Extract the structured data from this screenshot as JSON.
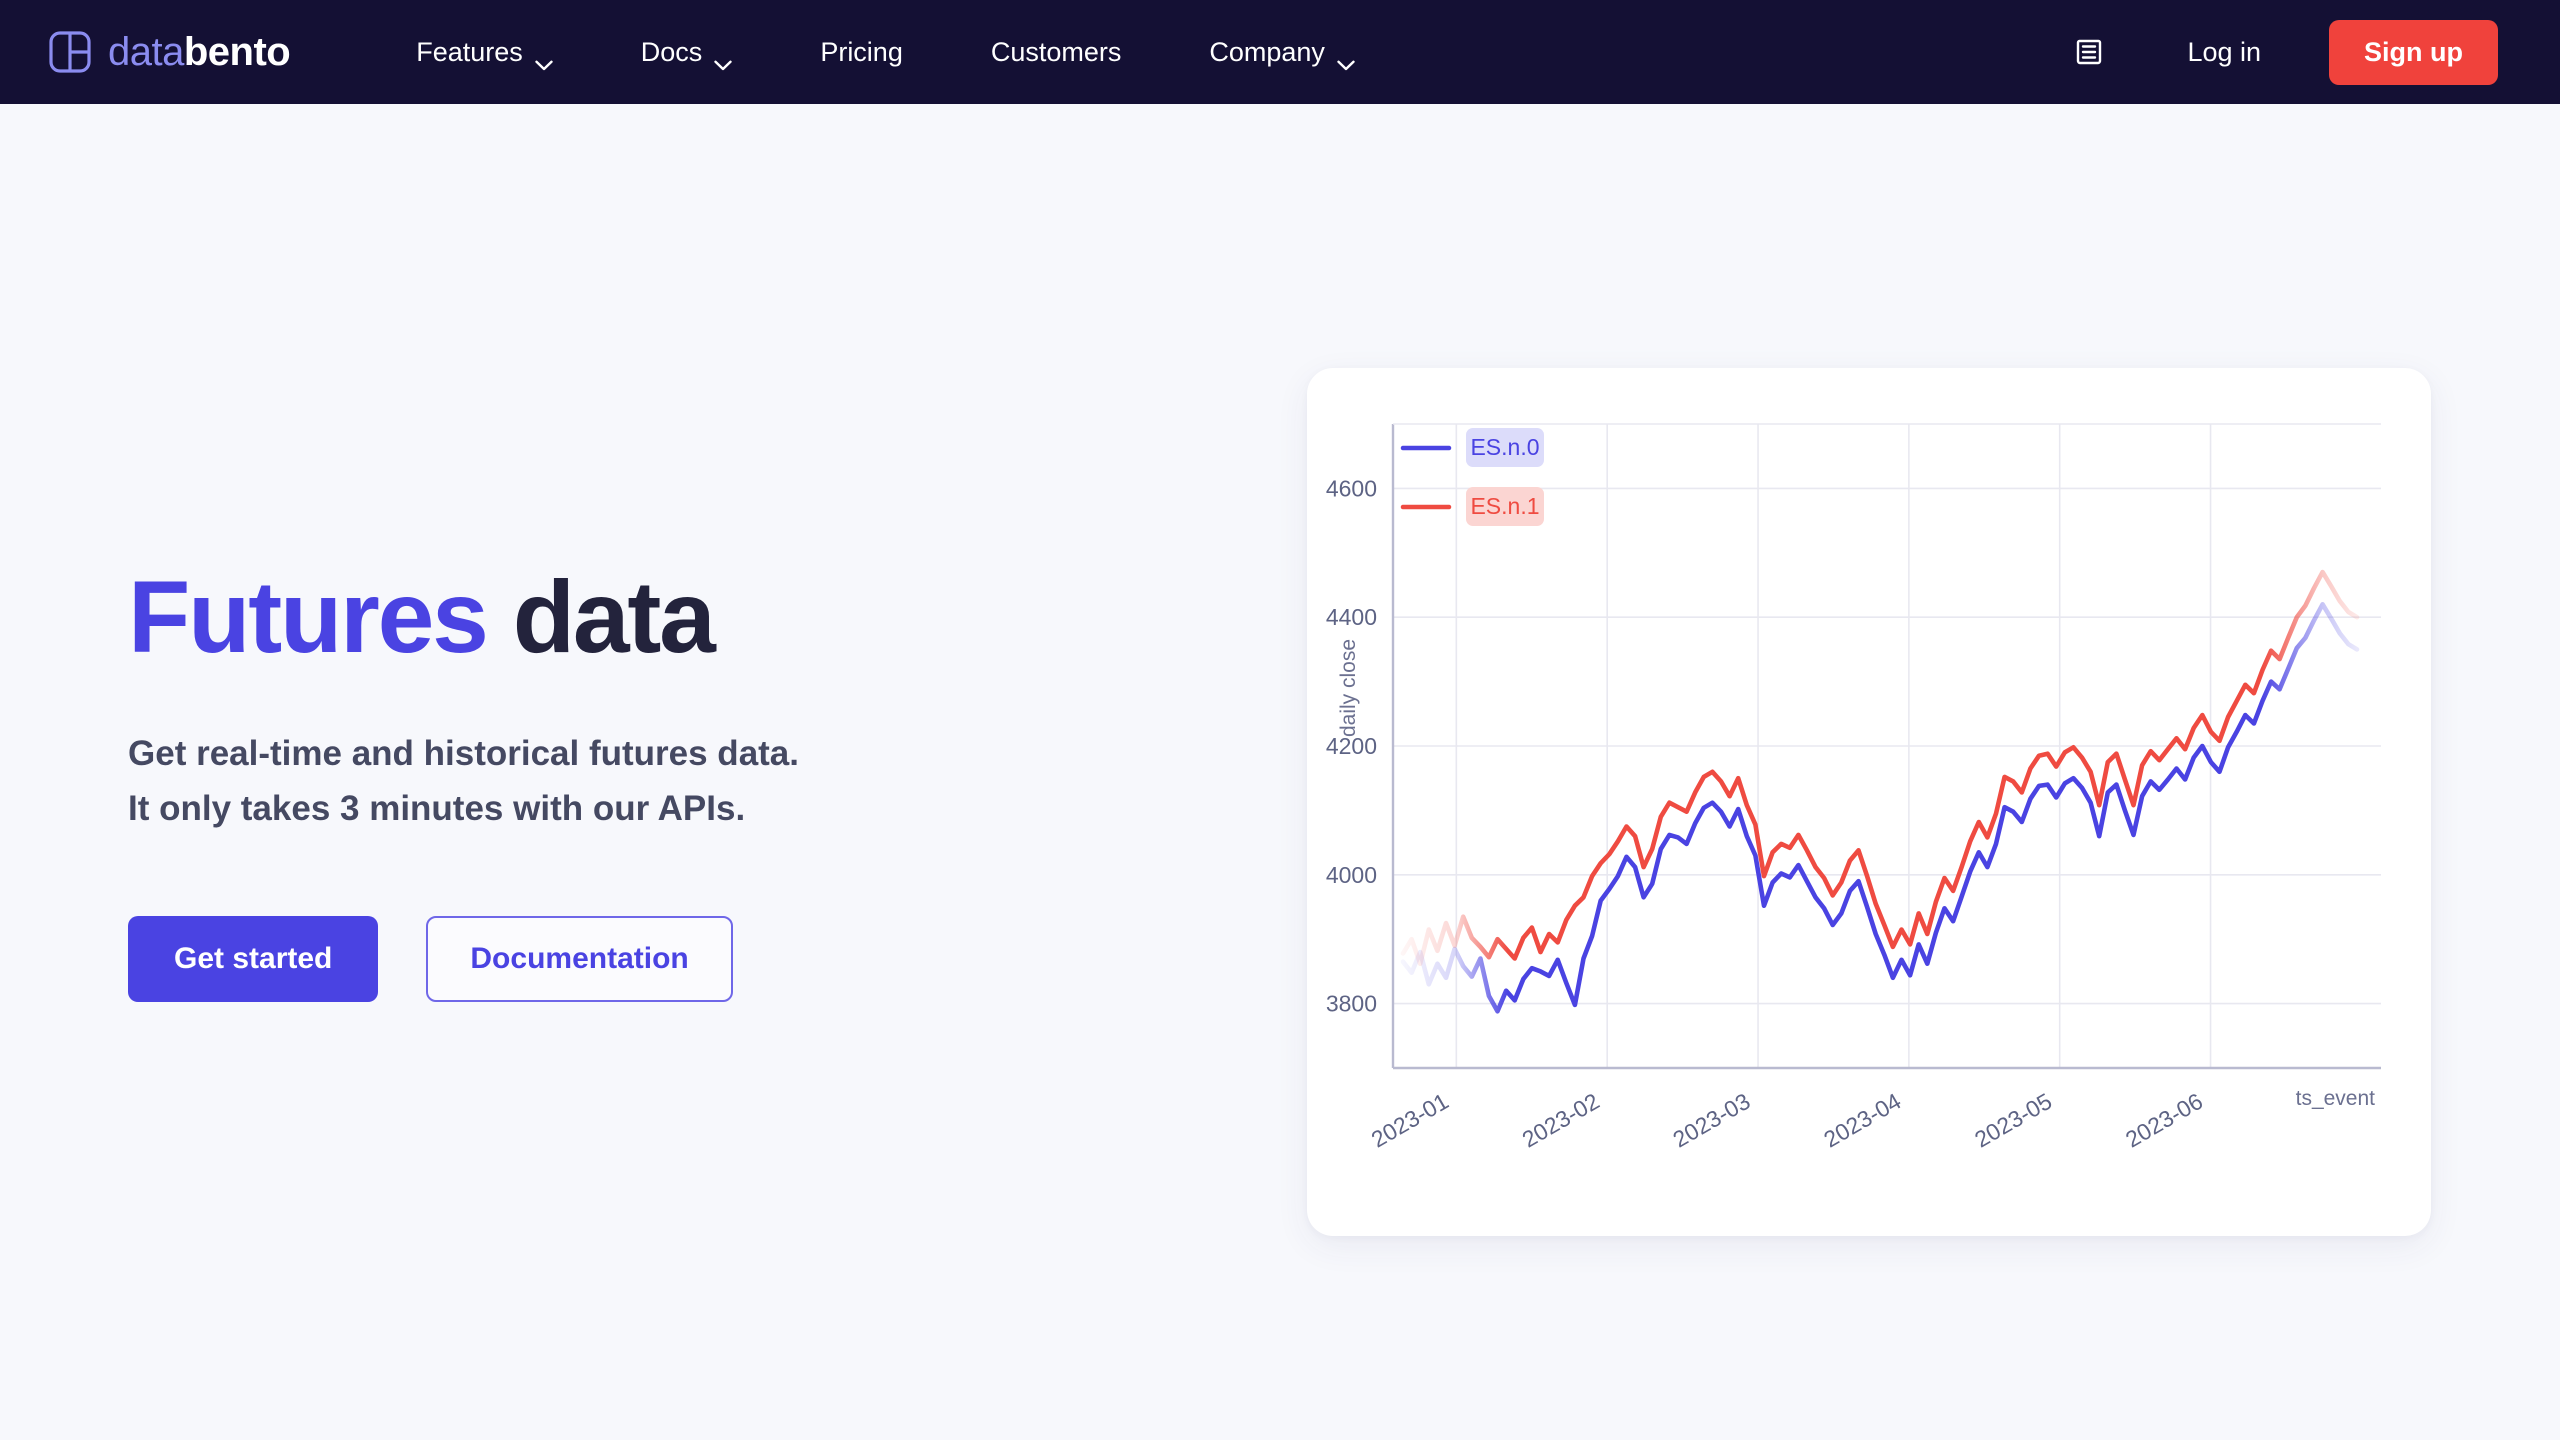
{
  "navbar": {
    "brand": {
      "part_a": "data",
      "part_b": "bento",
      "logo_icon": "bento-box-logo-icon"
    },
    "links": [
      {
        "label": "Features",
        "has_chevron": true,
        "icon": "chevron-down-icon"
      },
      {
        "label": "Docs",
        "has_chevron": true,
        "icon": "chevron-down-icon"
      },
      {
        "label": "Pricing",
        "has_chevron": false
      },
      {
        "label": "Customers",
        "has_chevron": false
      },
      {
        "label": "Company",
        "has_chevron": true,
        "icon": "chevron-down-icon"
      }
    ],
    "docs_icon": "docs-list-icon",
    "login_label": "Log in",
    "signup_label": "Sign up",
    "colors": {
      "background": "#141034",
      "signup_bg": "#f0423c",
      "brand_accent": "#8b8cf0"
    }
  },
  "hero": {
    "title_accent": "Futures",
    "title_plain": "data",
    "subtitle_line1": "Get real-time and historical futures data.",
    "subtitle_line2": "It only takes 3 minutes with our APIs.",
    "primary_cta": "Get started",
    "secondary_cta": "Documentation",
    "colors": {
      "accent": "#4a43e2",
      "title_plain": "#23233c",
      "page_bg": "#f7f8fc"
    }
  },
  "chart_data": {
    "type": "line",
    "title": "",
    "xlabel": "ts_event",
    "ylabel": "daily close",
    "grid": true,
    "legend_position": "top-left",
    "ylim": [
      3700,
      4700
    ],
    "yticks": [
      3800,
      4000,
      4200,
      4400,
      4600
    ],
    "xticks": [
      "2023-01",
      "2023-02",
      "2023-03",
      "2023-04",
      "2023-05",
      "2023-06"
    ],
    "colors": {
      "ES.n.0": "#4a43e2",
      "ES.n.1": "#ef4b41",
      "ES.n.0_badge_bg": "#dcdcfa",
      "ES.n.1_badge_bg": "#fbd5d2",
      "grid": "#e8e8f0",
      "axis": "#b9bad0"
    },
    "series": [
      {
        "name": "ES.n.0",
        "values": [
          3865,
          3848,
          3880,
          3830,
          3862,
          3840,
          3885,
          3858,
          3842,
          3870,
          3812,
          3788,
          3820,
          3805,
          3838,
          3855,
          3850,
          3843,
          3868,
          3832,
          3798,
          3870,
          3905,
          3960,
          3978,
          3998,
          4028,
          4012,
          3965,
          3986,
          4040,
          4062,
          4058,
          4048,
          4080,
          4104,
          4112,
          4098,
          4075,
          4102,
          4060,
          4030,
          3952,
          3988,
          4002,
          3996,
          4015,
          3990,
          3965,
          3948,
          3922,
          3940,
          3975,
          3990,
          3950,
          3908,
          3876,
          3840,
          3868,
          3844,
          3892,
          3862,
          3910,
          3948,
          3928,
          3966,
          4005,
          4035,
          4012,
          4048,
          4105,
          4098,
          4082,
          4118,
          4138,
          4140,
          4120,
          4142,
          4150,
          4135,
          4112,
          4060,
          4128,
          4140,
          4100,
          4062,
          4122,
          4145,
          4132,
          4148,
          4165,
          4148,
          4182,
          4200,
          4175,
          4160,
          4198,
          4222,
          4248,
          4235,
          4270,
          4300,
          4288,
          4320,
          4352,
          4368,
          4395,
          4420,
          4398,
          4375,
          4358,
          4350
        ]
      },
      {
        "name": "ES.n.1",
        "values": [
          3878,
          3900,
          3862,
          3915,
          3882,
          3925,
          3890,
          3935,
          3902,
          3888,
          3872,
          3900,
          3885,
          3870,
          3902,
          3918,
          3880,
          3908,
          3895,
          3930,
          3952,
          3965,
          3998,
          4018,
          4032,
          4052,
          4075,
          4060,
          4012,
          4040,
          4090,
          4112,
          4105,
          4098,
          4128,
          4152,
          4160,
          4145,
          4122,
          4150,
          4108,
          4078,
          3998,
          4035,
          4048,
          4042,
          4062,
          4038,
          4012,
          3995,
          3968,
          3988,
          4022,
          4038,
          3998,
          3955,
          3922,
          3888,
          3915,
          3892,
          3940,
          3908,
          3958,
          3995,
          3975,
          4012,
          4052,
          4082,
          4058,
          4095,
          4152,
          4145,
          4128,
          4165,
          4185,
          4188,
          4168,
          4190,
          4198,
          4182,
          4160,
          4108,
          4175,
          4188,
          4148,
          4108,
          4170,
          4192,
          4178,
          4195,
          4212,
          4195,
          4228,
          4248,
          4222,
          4208,
          4245,
          4270,
          4295,
          4282,
          4318,
          4348,
          4335,
          4368,
          4400,
          4418,
          4445,
          4470,
          4448,
          4425,
          4408,
          4400
        ]
      }
    ]
  }
}
